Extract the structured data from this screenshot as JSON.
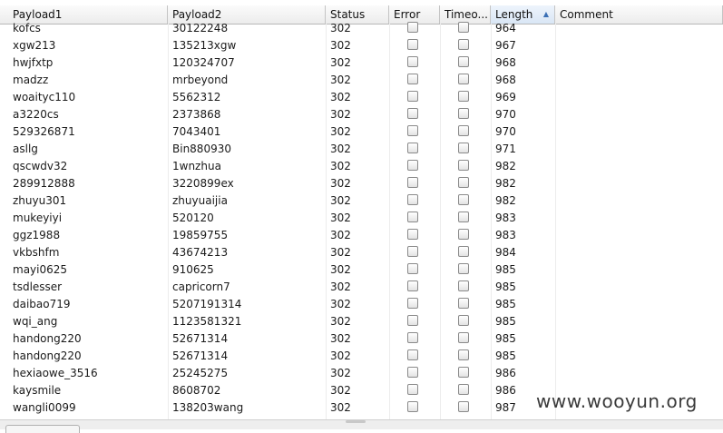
{
  "columns": [
    {
      "key": "payload1",
      "label": "Payload1"
    },
    {
      "key": "payload2",
      "label": "Payload2"
    },
    {
      "key": "status",
      "label": "Status"
    },
    {
      "key": "error",
      "label": "Error"
    },
    {
      "key": "timeout",
      "label": "Timeo..."
    },
    {
      "key": "length",
      "label": "Length"
    },
    {
      "key": "comment",
      "label": "Comment"
    }
  ],
  "sorted_column": "length",
  "sort_direction": "ascending",
  "rows": [
    {
      "payload1": "kofcs",
      "payload2": "30122248",
      "status": "302",
      "error": false,
      "timeout": false,
      "length": "964",
      "comment": ""
    },
    {
      "payload1": "xgw213",
      "payload2": "135213xgw",
      "status": "302",
      "error": false,
      "timeout": false,
      "length": "967",
      "comment": ""
    },
    {
      "payload1": "hwjfxtp",
      "payload2": "120324707",
      "status": "302",
      "error": false,
      "timeout": false,
      "length": "968",
      "comment": ""
    },
    {
      "payload1": "madzz",
      "payload2": "mrbeyond",
      "status": "302",
      "error": false,
      "timeout": false,
      "length": "968",
      "comment": ""
    },
    {
      "payload1": "woaityc110",
      "payload2": "5562312",
      "status": "302",
      "error": false,
      "timeout": false,
      "length": "969",
      "comment": ""
    },
    {
      "payload1": "a3220cs",
      "payload2": "2373868",
      "status": "302",
      "error": false,
      "timeout": false,
      "length": "970",
      "comment": ""
    },
    {
      "payload1": "529326871",
      "payload2": "7043401",
      "status": "302",
      "error": false,
      "timeout": false,
      "length": "970",
      "comment": ""
    },
    {
      "payload1": "asllg",
      "payload2": "Bin880930",
      "status": "302",
      "error": false,
      "timeout": false,
      "length": "971",
      "comment": ""
    },
    {
      "payload1": "qscwdv32",
      "payload2": "1wnzhua",
      "status": "302",
      "error": false,
      "timeout": false,
      "length": "982",
      "comment": ""
    },
    {
      "payload1": "289912888",
      "payload2": "3220899ex",
      "status": "302",
      "error": false,
      "timeout": false,
      "length": "982",
      "comment": ""
    },
    {
      "payload1": "zhuyu301",
      "payload2": "zhuyuaijia",
      "status": "302",
      "error": false,
      "timeout": false,
      "length": "982",
      "comment": ""
    },
    {
      "payload1": "mukeyiyi",
      "payload2": "520120",
      "status": "302",
      "error": false,
      "timeout": false,
      "length": "983",
      "comment": ""
    },
    {
      "payload1": "ggz1988",
      "payload2": "19859755",
      "status": "302",
      "error": false,
      "timeout": false,
      "length": "983",
      "comment": ""
    },
    {
      "payload1": "vkbshfm",
      "payload2": "43674213",
      "status": "302",
      "error": false,
      "timeout": false,
      "length": "984",
      "comment": ""
    },
    {
      "payload1": "mayi0625",
      "payload2": "910625",
      "status": "302",
      "error": false,
      "timeout": false,
      "length": "985",
      "comment": ""
    },
    {
      "payload1": "tsdlesser",
      "payload2": "capricorn7",
      "status": "302",
      "error": false,
      "timeout": false,
      "length": "985",
      "comment": ""
    },
    {
      "payload1": "daibao719",
      "payload2": "5207191314",
      "status": "302",
      "error": false,
      "timeout": false,
      "length": "985",
      "comment": ""
    },
    {
      "payload1": "wqi_ang",
      "payload2": "1123581321",
      "status": "302",
      "error": false,
      "timeout": false,
      "length": "985",
      "comment": ""
    },
    {
      "payload1": "handong220",
      "payload2": "52671314",
      "status": "302",
      "error": false,
      "timeout": false,
      "length": "985",
      "comment": ""
    },
    {
      "payload1": "handong220",
      "payload2": "52671314",
      "status": "302",
      "error": false,
      "timeout": false,
      "length": "985",
      "comment": ""
    },
    {
      "payload1": "hexiaowe_3516",
      "payload2": "25245275",
      "status": "302",
      "error": false,
      "timeout": false,
      "length": "986",
      "comment": ""
    },
    {
      "payload1": "kaysmile",
      "payload2": "8608702",
      "status": "302",
      "error": false,
      "timeout": false,
      "length": "986",
      "comment": ""
    },
    {
      "payload1": "wangli0099",
      "payload2": "138203wang",
      "status": "302",
      "error": false,
      "timeout": false,
      "length": "987",
      "comment": ""
    }
  ],
  "watermark": "www.wooyun.org",
  "colors": {
    "sorted_header": "#d9e6f5",
    "sort_arrow": "#3a6fb5"
  }
}
